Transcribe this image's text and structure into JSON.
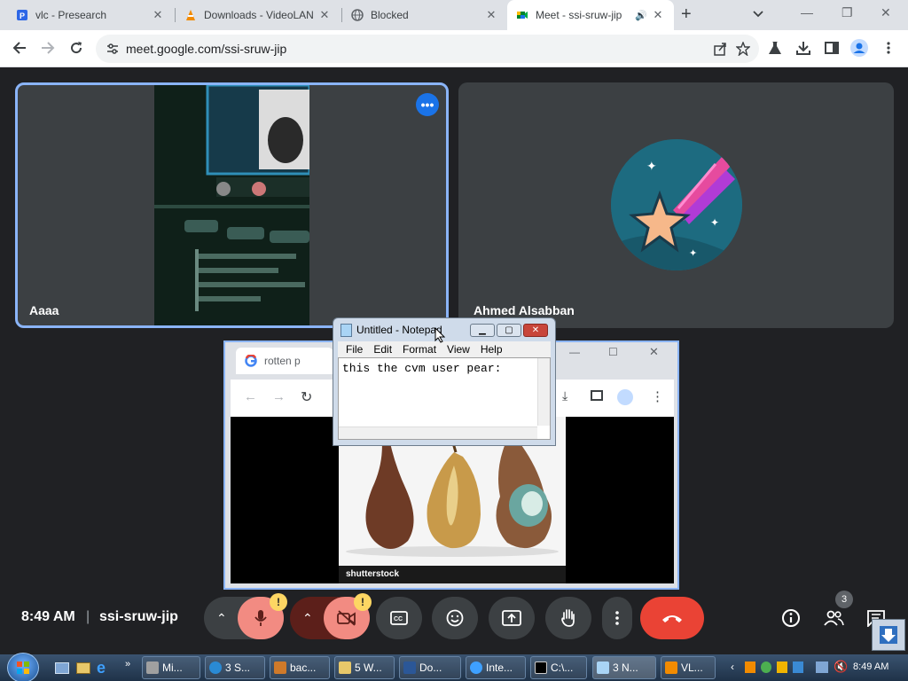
{
  "browser": {
    "tabs": [
      {
        "title": "vlc - Presearch"
      },
      {
        "title": "Downloads - VideoLAN"
      },
      {
        "title": "Blocked"
      },
      {
        "title": "Meet - ssi-sruw-jip"
      }
    ],
    "url": "meet.google.com/ssi-sruw-jip"
  },
  "meet": {
    "tiles": [
      {
        "name": "Aaaa"
      },
      {
        "name": "Ahmed Alsabban"
      }
    ],
    "time": "8:49 AM",
    "separator": "|",
    "meeting_code": "ssi-sruw-jip",
    "people_count": "3",
    "warn_badge": "!",
    "presented": {
      "tab_title": "rotten p",
      "watermark": "shutterstock"
    }
  },
  "notepad": {
    "title": "Untitled - Notepad",
    "menu": [
      "File",
      "Edit",
      "Format",
      "View",
      "Help"
    ],
    "text": "this the cvm user pear:"
  },
  "taskbar": {
    "items": [
      {
        "label": "Mi..."
      },
      {
        "label": "3 S..."
      },
      {
        "label": "bac..."
      },
      {
        "label": "5 W..."
      },
      {
        "label": "Do..."
      },
      {
        "label": "Inte..."
      },
      {
        "label": "C:\\..."
      },
      {
        "label": "3 N..."
      },
      {
        "label": "VL..."
      }
    ],
    "clock": "8:49 AM"
  },
  "colors": {
    "accent": "#8ab4f8",
    "end_call": "#ea4335",
    "meet_bg": "#202124",
    "tile_bg": "#3c4043",
    "muted_bg": "#f28b82",
    "warn": "#fdd663"
  }
}
